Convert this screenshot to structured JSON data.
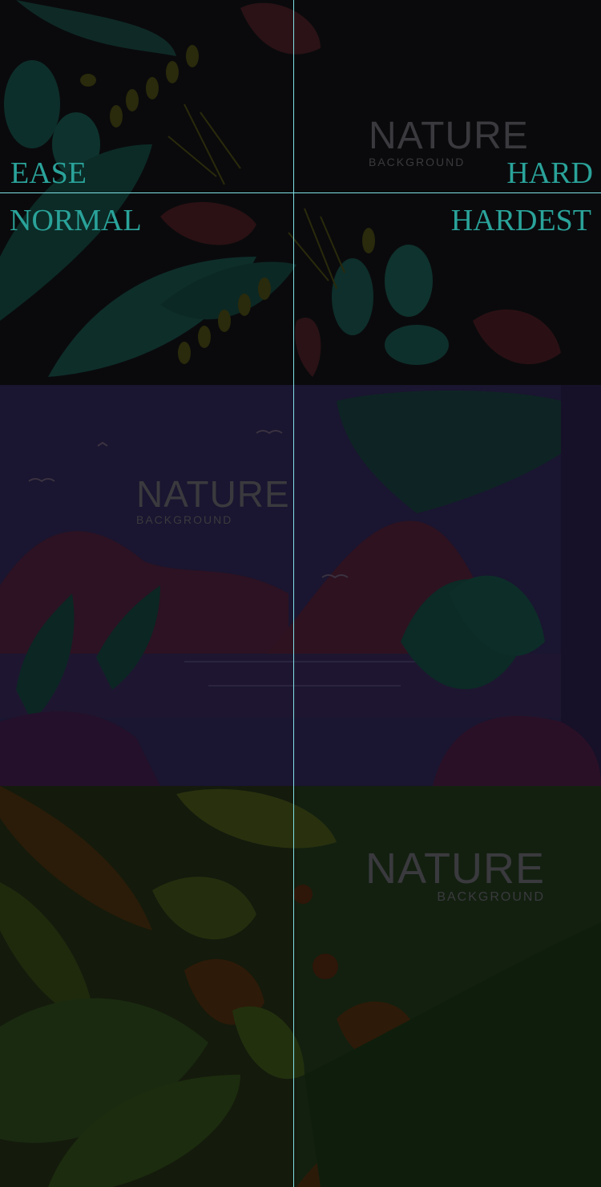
{
  "difficulty": {
    "ease": "EASE",
    "normal": "NORMAL",
    "hard": "HARD",
    "hardest": "HARDEST"
  },
  "watermarks": [
    {
      "title": "NATURE",
      "subtitle": "BACKGROUND"
    },
    {
      "title": "NATURE",
      "subtitle": "BACKGROUND"
    },
    {
      "title": "NATURE",
      "subtitle": "BACKGROUND"
    }
  ],
  "colors": {
    "divider": "#7fe0e6",
    "label": "#2aa39a"
  }
}
